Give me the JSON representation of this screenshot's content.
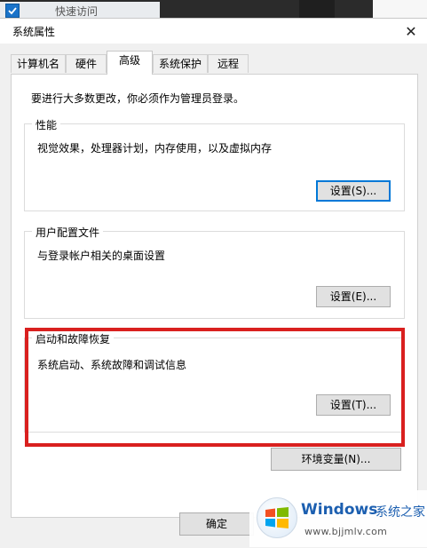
{
  "background": {
    "quick_access_label": "快速访问"
  },
  "window": {
    "title": "系统属性",
    "close_glyph": "✕"
  },
  "tabs": [
    {
      "label": "计算机名"
    },
    {
      "label": "硬件"
    },
    {
      "label": "高级",
      "active": true
    },
    {
      "label": "系统保护"
    },
    {
      "label": "远程"
    }
  ],
  "advanced": {
    "admin_notice": "要进行大多数更改，你必须作为管理员登录。",
    "performance": {
      "title": "性能",
      "description": "视觉效果，处理器计划，内存使用，以及虚拟内存",
      "settings_button": "设置(S)..."
    },
    "user_profiles": {
      "title": "用户配置文件",
      "description": "与登录帐户相关的桌面设置",
      "settings_button": "设置(E)..."
    },
    "startup_recovery": {
      "title": "启动和故障恢复",
      "description": "系统启动、系统故障和调试信息",
      "settings_button": "设置(T)..."
    },
    "env_vars_button": "环境变量(N)..."
  },
  "footer": {
    "ok_button": "确定"
  },
  "watermark": {
    "brand": "Windows",
    "brand_cn": "系统之家",
    "url": "www.bjjmlv.com"
  },
  "colors": {
    "highlight_red": "#d9201f",
    "focus_blue": "#0078d7",
    "brand_blue": "#1c5fb0"
  }
}
